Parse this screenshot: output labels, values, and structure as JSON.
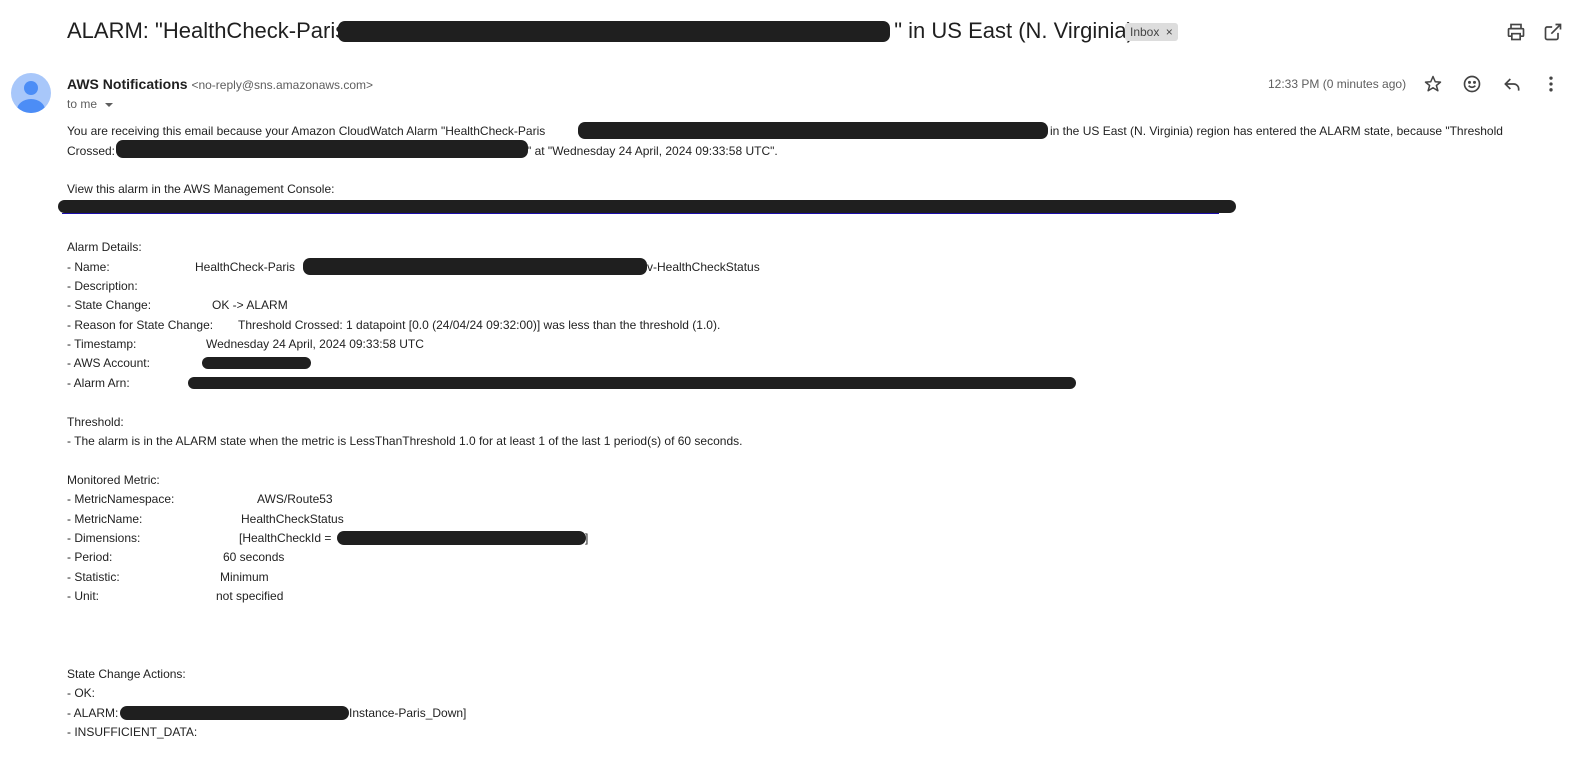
{
  "subject": {
    "prefix": "ALARM: \"HealthCheck-Paris",
    "suffix": "\" in US East (N. Virginia)",
    "label": "Inbox",
    "label_close": "×"
  },
  "sender": {
    "name": "AWS Notifications",
    "email": "<no-reply@sns.amazonaws.com>",
    "to": "to me",
    "time": "12:33 PM (0 minutes ago)"
  },
  "body": {
    "intro_1": "You are receiving this email because your Amazon CloudWatch Alarm \"HealthCheck-Paris",
    "intro_2": "in the US East (N. Virginia) region has entered the ALARM state, because \"Threshold",
    "intro_3": "Crossed:",
    "intro_4": "\" at \"Wednesday 24 April, 2024 09:33:58 UTC\".",
    "console_label": "View this alarm in the AWS Management Console:",
    "alarm_details_header": "Alarm Details:",
    "name_key": "- Name:",
    "name_val_prefix": "HealthCheck-Paris",
    "name_val_suffix": "v-HealthCheckStatus",
    "desc_key": "- Description:",
    "state_key": "- State Change:",
    "state_val": "OK -> ALARM",
    "reason_key": "- Reason for State Change:",
    "reason_val": "Threshold Crossed: 1 datapoint [0.0 (24/04/24 09:32:00)] was less than the threshold (1.0).",
    "timestamp_key": "- Timestamp:",
    "timestamp_val": "Wednesday 24 April, 2024 09:33:58 UTC",
    "account_key": "- AWS Account:",
    "arn_key": "- Alarm Arn:",
    "threshold_header": "Threshold:",
    "threshold_val": "- The alarm is in the ALARM state when the metric is LessThanThreshold 1.0 for at least 1 of the last 1 period(s) of 60 seconds.",
    "metric_header": "Monitored Metric:",
    "ns_key": "- MetricNamespace:",
    "ns_val": "AWS/Route53",
    "mname_key": "- MetricName:",
    "mname_val": "HealthCheckStatus",
    "dim_key": "- Dimensions:",
    "dim_val_prefix": "[HealthCheckId =",
    "dim_val_suffix": "]",
    "period_key": "- Period:",
    "period_val": "60 seconds",
    "stat_key": "- Statistic:",
    "stat_val": "Minimum",
    "unit_key": "- Unit:",
    "unit_val": "not specified",
    "actions_header": "State Change Actions:",
    "ok_key": "- OK:",
    "alarm_key": "- ALARM:",
    "alarm_val_suffix": "Instance-Paris_Down]",
    "insuff_key": "- INSUFFICIENT_DATA:"
  },
  "icons": {
    "print": "print-icon",
    "popout": "open-in-new-icon",
    "star": "star-icon",
    "emoji": "emoji-icon",
    "reply": "reply-icon",
    "more": "more-vert-icon",
    "dropdown": "chevron-down-icon",
    "avatar": "person-icon"
  },
  "colors": {
    "redaction": "#1f1f1f",
    "link": "#1a0dab",
    "avatar_bg": "#a8c7fa",
    "avatar_fg": "#4c8df6"
  }
}
